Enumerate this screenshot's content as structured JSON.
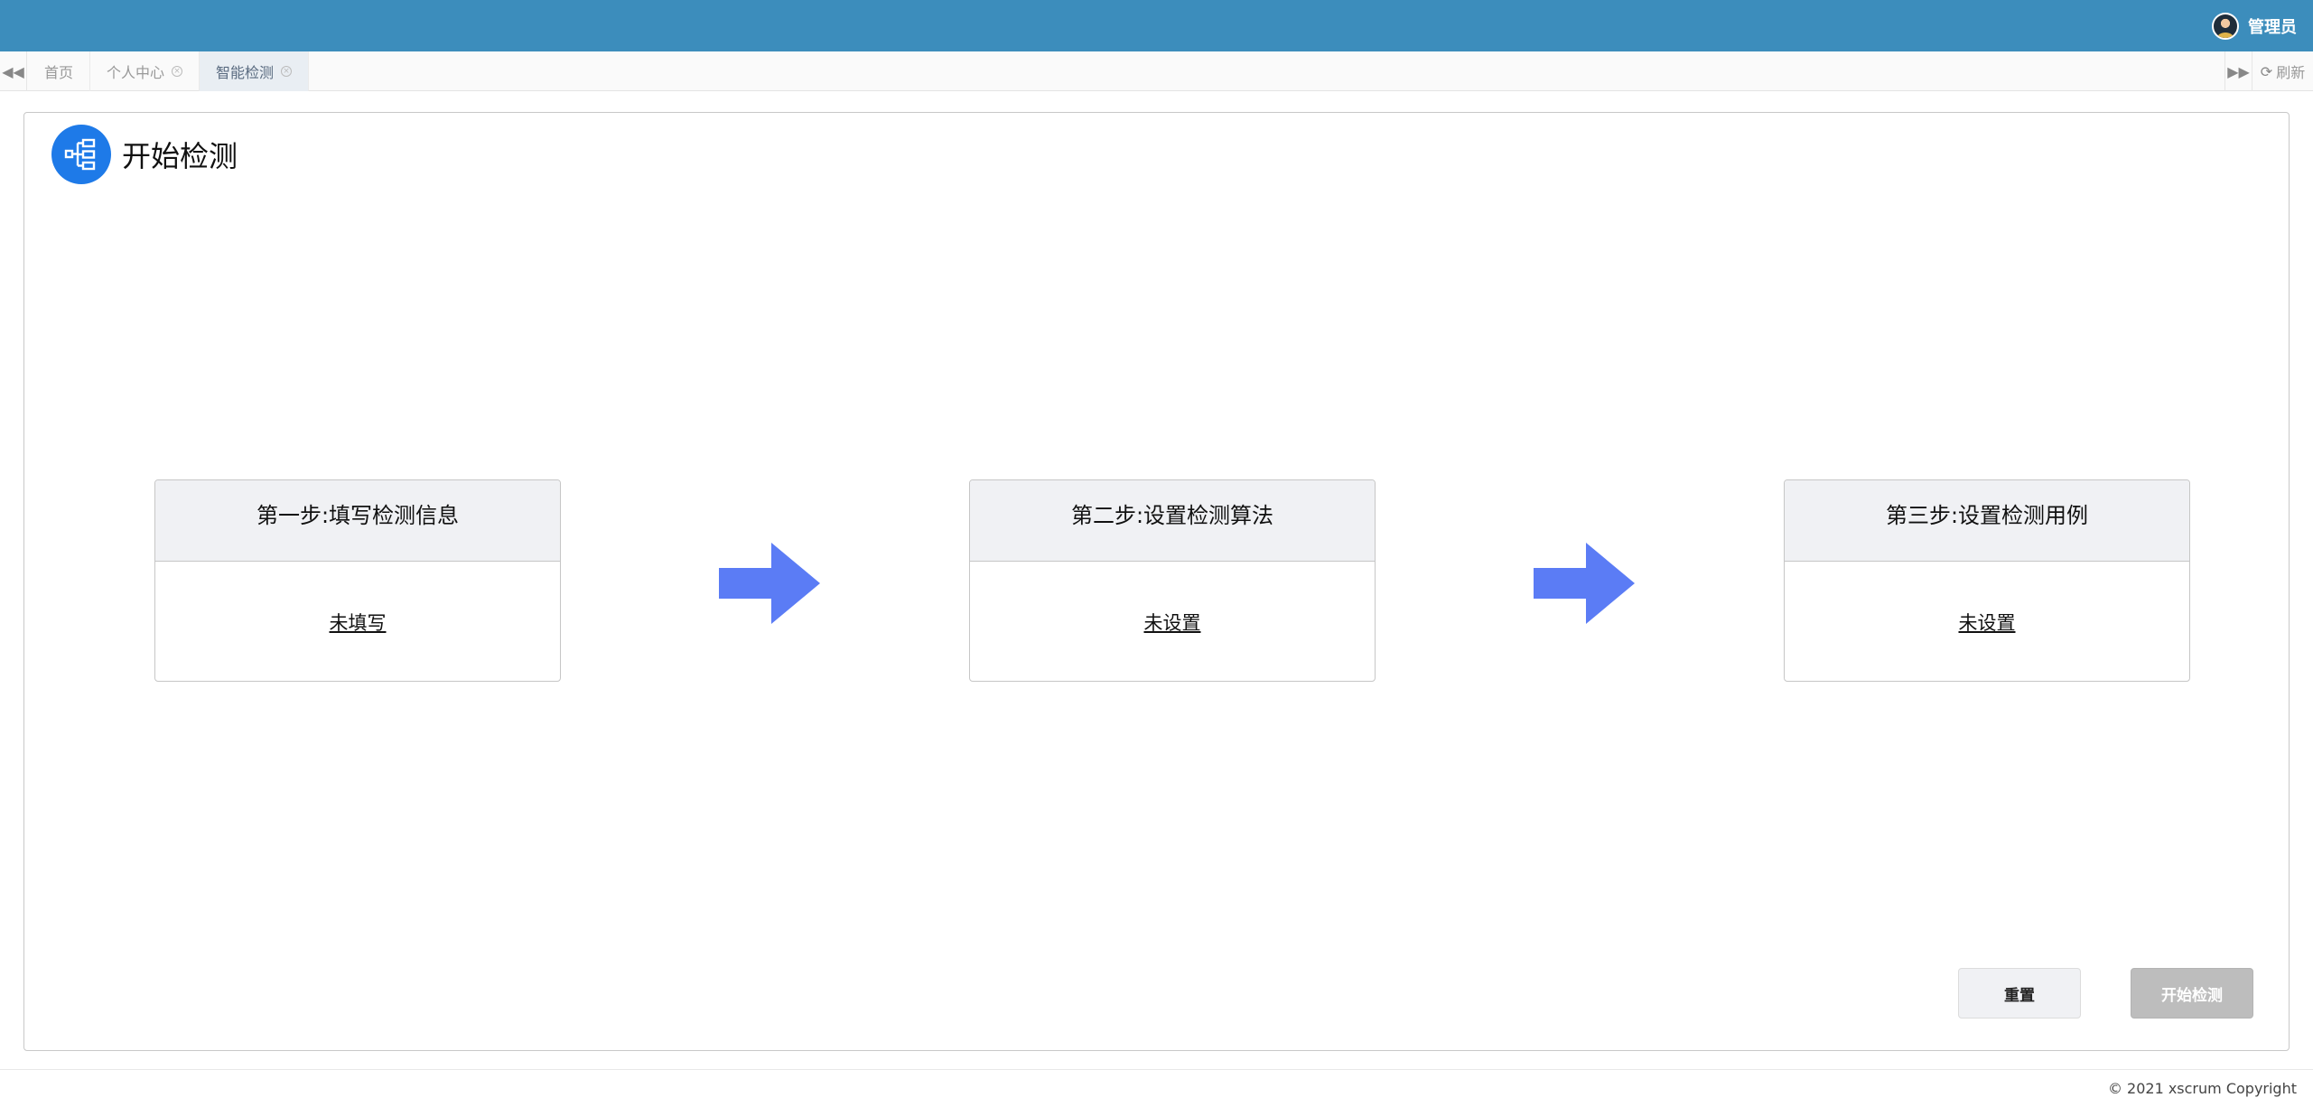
{
  "header": {
    "user_name": "管理员"
  },
  "tabs": [
    {
      "label": "首页",
      "closable": false,
      "active": false
    },
    {
      "label": "个人中心",
      "closable": true,
      "active": false
    },
    {
      "label": "智能检测",
      "closable": true,
      "active": true
    }
  ],
  "toolbar": {
    "refresh_label": "刷新"
  },
  "panel": {
    "title": "开始检测",
    "icon": "sitemap-icon"
  },
  "steps": [
    {
      "title": "第一步:填写检测信息",
      "status": "未填写"
    },
    {
      "title": "第二步:设置检测算法",
      "status": "未设置"
    },
    {
      "title": "第三步:设置检测用例",
      "status": "未设置"
    }
  ],
  "actions": {
    "reset_label": "重置",
    "start_label": "开始检测"
  },
  "footer": {
    "copyright": "© 2021 xscrum Copyright"
  },
  "colors": {
    "header_bg": "#3c8dbc",
    "icon_circle": "#1e7ae8",
    "arrow": "#5b7cf5",
    "start_disabled": "#bdbdbd"
  }
}
